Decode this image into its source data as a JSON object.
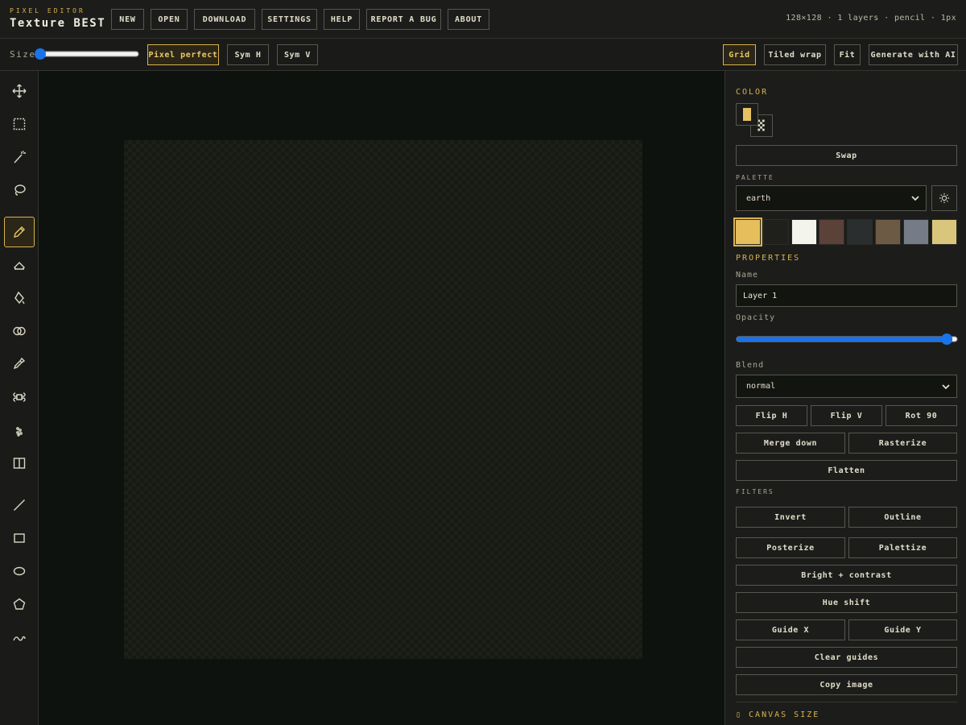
{
  "app": {
    "subtitle": "PIXEL EDITOR",
    "title": "Texture BEST",
    "status": "128×128 · 1 layers · pencil · 1px"
  },
  "menu": [
    "NEW",
    "OPEN",
    "DOWNLOAD",
    "SETTINGS",
    "HELP",
    "REPORT A BUG",
    "ABOUT"
  ],
  "toolbar": {
    "size_label": "Size",
    "size_value": 1,
    "pixel_perfect": "Pixel perfect",
    "sym_h": "Sym H",
    "sym_v": "Sym V",
    "grid": "Grid",
    "tiled_wrap": "Tiled wrap",
    "fit": "Fit",
    "generate_ai": "Generate with AI"
  },
  "tools": [
    {
      "icon": "move-icon"
    },
    {
      "icon": "marquee-select-icon"
    },
    {
      "icon": "magic-wand-icon"
    },
    {
      "icon": "lasso-icon"
    },
    {
      "icon": "pencil-icon",
      "active": true
    },
    {
      "icon": "eraser-icon"
    },
    {
      "icon": "fill-bucket-icon"
    },
    {
      "icon": "blend-circles-icon"
    },
    {
      "icon": "eyedropper-icon"
    },
    {
      "icon": "pattern-icon"
    },
    {
      "icon": "spray-icon"
    },
    {
      "icon": "mirror-split-icon"
    },
    {
      "icon": "line-icon"
    },
    {
      "icon": "rectangle-icon"
    },
    {
      "icon": "ellipse-icon"
    },
    {
      "icon": "polygon-icon"
    },
    {
      "icon": "curve-icon"
    }
  ],
  "panel": {
    "color_title": "COLOR",
    "primary_color": "#e8c262",
    "swap": "Swap",
    "palette_title": "PALETTE",
    "palette_value": "earth",
    "palette_colors": [
      "#e6bf5c",
      "#1f1f1c",
      "#f3f4ec",
      "#5a4238",
      "#2b2e2e",
      "#6d5a45",
      "#767c87",
      "#d9c67c"
    ],
    "properties_title": "PROPERTIES",
    "name_label": "Name",
    "name_value": "Layer 1",
    "opacity_label": "Opacity",
    "opacity_value": 97,
    "blend_label": "Blend",
    "blend_value": "normal",
    "flip_h": "Flip H",
    "flip_v": "Flip V",
    "rot_90": "Rot 90",
    "merge_down": "Merge down",
    "rasterize": "Rasterize",
    "flatten": "Flatten",
    "filters_title": "FILTERS",
    "invert": "Invert",
    "outline": "Outline",
    "posterize": "Posterize",
    "palettize": "Palettize",
    "bright_contrast": "Bright + contrast",
    "hue_shift": "Hue shift",
    "guide_x": "Guide X",
    "guide_y": "Guide Y",
    "clear_guides": "Clear guides",
    "copy_image": "Copy image",
    "canvas_size_title": "▯ CANVAS SIZE"
  },
  "colors": {
    "accent": "#d8b24f",
    "background": "#0e120e",
    "panel": "#1c1d1a"
  }
}
